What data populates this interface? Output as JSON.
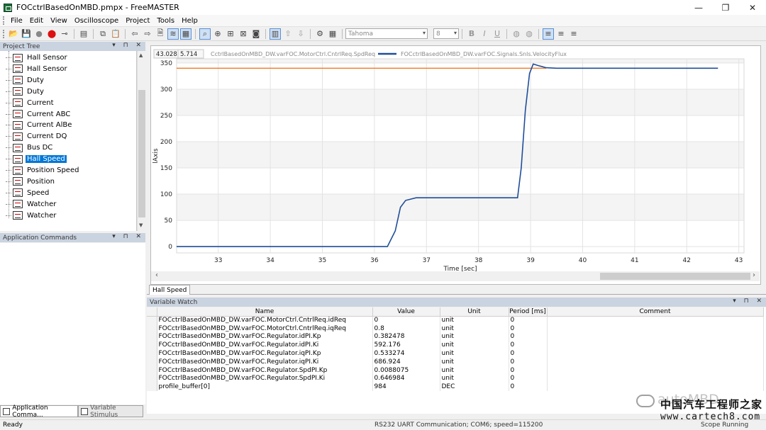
{
  "window": {
    "title": "FOCctrlBasedOnMBD.pmpx - FreeMASTER",
    "minimize": "—",
    "maximize": "❐",
    "close": "✕"
  },
  "menu": [
    "File",
    "Edit",
    "View",
    "Oscilloscope",
    "Project",
    "Tools",
    "Help"
  ],
  "toolbar": {
    "font_name": "Tahoma",
    "font_size": "8"
  },
  "project_tree": {
    "header": "Project Tree",
    "items": [
      {
        "label": "Hall Sensor",
        "selected": false
      },
      {
        "label": "Hall Sensor",
        "selected": false
      },
      {
        "label": "Duty",
        "selected": false
      },
      {
        "label": "Duty",
        "selected": false
      },
      {
        "label": "Current",
        "selected": false
      },
      {
        "label": "Current ABC",
        "selected": false
      },
      {
        "label": "Current AlBe",
        "selected": false
      },
      {
        "label": "Current DQ",
        "selected": false
      },
      {
        "label": "Bus DC",
        "selected": false
      },
      {
        "label": "Hall Speed",
        "selected": true
      },
      {
        "label": "Position Speed",
        "selected": false
      },
      {
        "label": "Position",
        "selected": false
      },
      {
        "label": "Speed",
        "selected": false
      },
      {
        "label": "Watcher",
        "selected": false
      },
      {
        "label": "Watcher",
        "selected": false
      }
    ]
  },
  "application_commands": {
    "header": "Application Commands"
  },
  "bottom_tabs": [
    "Application Comma...",
    "Variable Stimulus"
  ],
  "plot_tabs": [
    "Hall Speed"
  ],
  "chart_data": {
    "type": "line",
    "cursor_readout": [
      "43.028",
      "5.714"
    ],
    "xlabel": "Time [sec]",
    "ylabel": "lAxis",
    "xlim": [
      32.2,
      43.1
    ],
    "ylim": [
      -12,
      358
    ],
    "xticks": [
      33,
      34,
      35,
      36,
      37,
      38,
      39,
      40,
      41,
      42,
      43
    ],
    "yticks": [
      0,
      50,
      100,
      150,
      200,
      250,
      300,
      350
    ],
    "grid": true,
    "legend_position": "top",
    "series": [
      {
        "name": "CctrlBasedOnMBD_DW.varFOC.MotorCtrl.CntrlReq.SpdReq",
        "color": "#f07a24",
        "x": [
          32.2,
          39.3
        ],
        "y": [
          340,
          340
        ]
      },
      {
        "name": "FOCctrlBasedOnMBD_DW.varFOC.Signals.Snls.VelocityFlux",
        "color": "#1f4e99",
        "x": [
          32.2,
          36.25,
          36.4,
          36.5,
          36.6,
          36.8,
          37.0,
          37.5,
          38.0,
          38.5,
          38.75,
          38.82,
          38.9,
          38.98,
          39.05,
          39.15,
          39.3,
          39.5,
          40.0,
          41.0,
          42.0,
          42.6
        ],
        "y": [
          0,
          0,
          30,
          75,
          88,
          93,
          93,
          93,
          93,
          93,
          93,
          150,
          260,
          330,
          348,
          345,
          341,
          340,
          340,
          340,
          340,
          340
        ]
      }
    ],
    "legend_colors": [
      "#f07a24",
      "#1f4e99"
    ]
  },
  "variable_watch": {
    "header": "Variable Watch",
    "columns": [
      "Name",
      "Value",
      "Unit",
      "Period [ms]",
      "Comment"
    ],
    "rows": [
      {
        "name": "FOCctrlBasedOnMBD_DW.varFOC.MotorCtrl.CntrlReq.idReq",
        "value": "0",
        "unit": "unit",
        "period": "0",
        "comment": ""
      },
      {
        "name": "FOCctrlBasedOnMBD_DW.varFOC.MotorCtrl.CntrlReq.iqReq",
        "value": "0.8",
        "unit": "unit",
        "period": "0",
        "comment": ""
      },
      {
        "name": "FOCctrlBasedOnMBD_DW.varFOC.Regulator.idPI.Kp",
        "value": "0.382478",
        "unit": "unit",
        "period": "0",
        "comment": ""
      },
      {
        "name": "FOCctrlBasedOnMBD_DW.varFOC.Regulator.idPI.Ki",
        "value": "592.176",
        "unit": "unit",
        "period": "0",
        "comment": ""
      },
      {
        "name": "FOCctrlBasedOnMBD_DW.varFOC.Regulator.iqPI.Kp",
        "value": "0.533274",
        "unit": "unit",
        "period": "0",
        "comment": ""
      },
      {
        "name": "FOCctrlBasedOnMBD_DW.varFOC.Regulator.iqPI.Ki",
        "value": "686.924",
        "unit": "unit",
        "period": "0",
        "comment": ""
      },
      {
        "name": "FOCctrlBasedOnMBD_DW.varFOC.Regulator.SpdPI.Kp",
        "value": "0.0088075",
        "unit": "unit",
        "period": "0",
        "comment": ""
      },
      {
        "name": "FOCctrlBasedOnMBD_DW.varFOC.Regulator.SpdPI.Ki",
        "value": "0.646984",
        "unit": "unit",
        "period": "0",
        "comment": ""
      },
      {
        "name": "profile_buffer[0]",
        "value": "984",
        "unit": "DEC",
        "period": "0",
        "comment": ""
      }
    ]
  },
  "status": {
    "left": "Ready",
    "center": "RS232 UART Communication; COM6; speed=115200",
    "right": "Scope Running"
  },
  "watermark": {
    "faint": "autoMBD",
    "cn": "中国汽车工程师之家",
    "url": "www.cartech8.com"
  }
}
